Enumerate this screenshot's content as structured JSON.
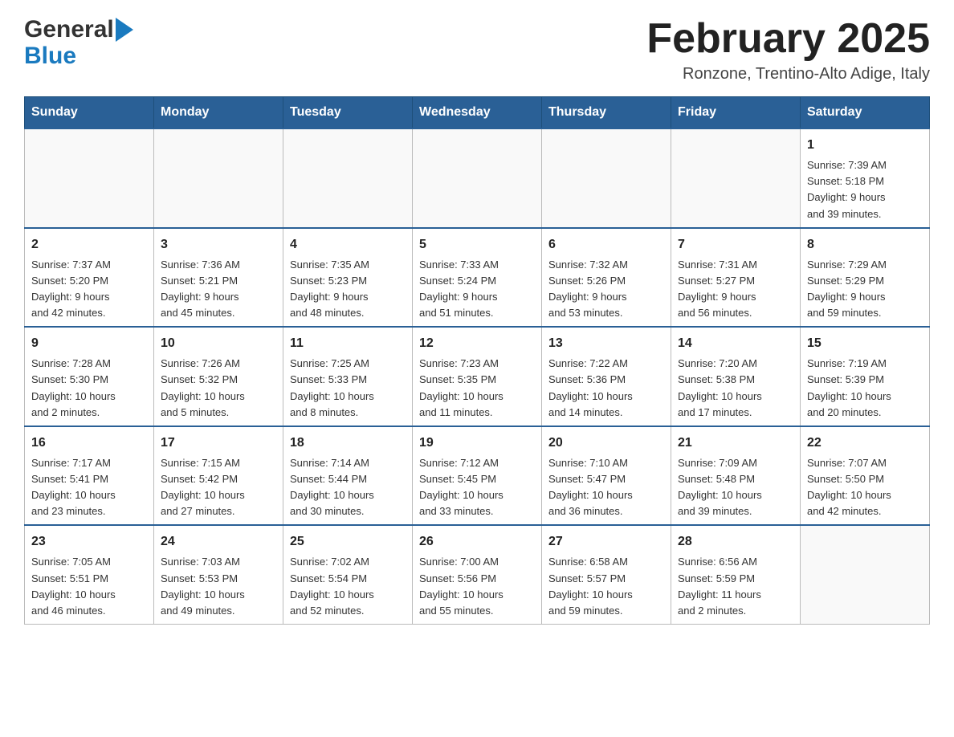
{
  "header": {
    "logo_general": "General",
    "logo_blue": "Blue",
    "month_title": "February 2025",
    "location": "Ronzone, Trentino-Alto Adige, Italy"
  },
  "days_of_week": [
    "Sunday",
    "Monday",
    "Tuesday",
    "Wednesday",
    "Thursday",
    "Friday",
    "Saturday"
  ],
  "weeks": [
    {
      "days": [
        {
          "num": "",
          "info": ""
        },
        {
          "num": "",
          "info": ""
        },
        {
          "num": "",
          "info": ""
        },
        {
          "num": "",
          "info": ""
        },
        {
          "num": "",
          "info": ""
        },
        {
          "num": "",
          "info": ""
        },
        {
          "num": "1",
          "info": "Sunrise: 7:39 AM\nSunset: 5:18 PM\nDaylight: 9 hours\nand 39 minutes."
        }
      ]
    },
    {
      "days": [
        {
          "num": "2",
          "info": "Sunrise: 7:37 AM\nSunset: 5:20 PM\nDaylight: 9 hours\nand 42 minutes."
        },
        {
          "num": "3",
          "info": "Sunrise: 7:36 AM\nSunset: 5:21 PM\nDaylight: 9 hours\nand 45 minutes."
        },
        {
          "num": "4",
          "info": "Sunrise: 7:35 AM\nSunset: 5:23 PM\nDaylight: 9 hours\nand 48 minutes."
        },
        {
          "num": "5",
          "info": "Sunrise: 7:33 AM\nSunset: 5:24 PM\nDaylight: 9 hours\nand 51 minutes."
        },
        {
          "num": "6",
          "info": "Sunrise: 7:32 AM\nSunset: 5:26 PM\nDaylight: 9 hours\nand 53 minutes."
        },
        {
          "num": "7",
          "info": "Sunrise: 7:31 AM\nSunset: 5:27 PM\nDaylight: 9 hours\nand 56 minutes."
        },
        {
          "num": "8",
          "info": "Sunrise: 7:29 AM\nSunset: 5:29 PM\nDaylight: 9 hours\nand 59 minutes."
        }
      ]
    },
    {
      "days": [
        {
          "num": "9",
          "info": "Sunrise: 7:28 AM\nSunset: 5:30 PM\nDaylight: 10 hours\nand 2 minutes."
        },
        {
          "num": "10",
          "info": "Sunrise: 7:26 AM\nSunset: 5:32 PM\nDaylight: 10 hours\nand 5 minutes."
        },
        {
          "num": "11",
          "info": "Sunrise: 7:25 AM\nSunset: 5:33 PM\nDaylight: 10 hours\nand 8 minutes."
        },
        {
          "num": "12",
          "info": "Sunrise: 7:23 AM\nSunset: 5:35 PM\nDaylight: 10 hours\nand 11 minutes."
        },
        {
          "num": "13",
          "info": "Sunrise: 7:22 AM\nSunset: 5:36 PM\nDaylight: 10 hours\nand 14 minutes."
        },
        {
          "num": "14",
          "info": "Sunrise: 7:20 AM\nSunset: 5:38 PM\nDaylight: 10 hours\nand 17 minutes."
        },
        {
          "num": "15",
          "info": "Sunrise: 7:19 AM\nSunset: 5:39 PM\nDaylight: 10 hours\nand 20 minutes."
        }
      ]
    },
    {
      "days": [
        {
          "num": "16",
          "info": "Sunrise: 7:17 AM\nSunset: 5:41 PM\nDaylight: 10 hours\nand 23 minutes."
        },
        {
          "num": "17",
          "info": "Sunrise: 7:15 AM\nSunset: 5:42 PM\nDaylight: 10 hours\nand 27 minutes."
        },
        {
          "num": "18",
          "info": "Sunrise: 7:14 AM\nSunset: 5:44 PM\nDaylight: 10 hours\nand 30 minutes."
        },
        {
          "num": "19",
          "info": "Sunrise: 7:12 AM\nSunset: 5:45 PM\nDaylight: 10 hours\nand 33 minutes."
        },
        {
          "num": "20",
          "info": "Sunrise: 7:10 AM\nSunset: 5:47 PM\nDaylight: 10 hours\nand 36 minutes."
        },
        {
          "num": "21",
          "info": "Sunrise: 7:09 AM\nSunset: 5:48 PM\nDaylight: 10 hours\nand 39 minutes."
        },
        {
          "num": "22",
          "info": "Sunrise: 7:07 AM\nSunset: 5:50 PM\nDaylight: 10 hours\nand 42 minutes."
        }
      ]
    },
    {
      "days": [
        {
          "num": "23",
          "info": "Sunrise: 7:05 AM\nSunset: 5:51 PM\nDaylight: 10 hours\nand 46 minutes."
        },
        {
          "num": "24",
          "info": "Sunrise: 7:03 AM\nSunset: 5:53 PM\nDaylight: 10 hours\nand 49 minutes."
        },
        {
          "num": "25",
          "info": "Sunrise: 7:02 AM\nSunset: 5:54 PM\nDaylight: 10 hours\nand 52 minutes."
        },
        {
          "num": "26",
          "info": "Sunrise: 7:00 AM\nSunset: 5:56 PM\nDaylight: 10 hours\nand 55 minutes."
        },
        {
          "num": "27",
          "info": "Sunrise: 6:58 AM\nSunset: 5:57 PM\nDaylight: 10 hours\nand 59 minutes."
        },
        {
          "num": "28",
          "info": "Sunrise: 6:56 AM\nSunset: 5:59 PM\nDaylight: 11 hours\nand 2 minutes."
        },
        {
          "num": "",
          "info": ""
        }
      ]
    }
  ]
}
